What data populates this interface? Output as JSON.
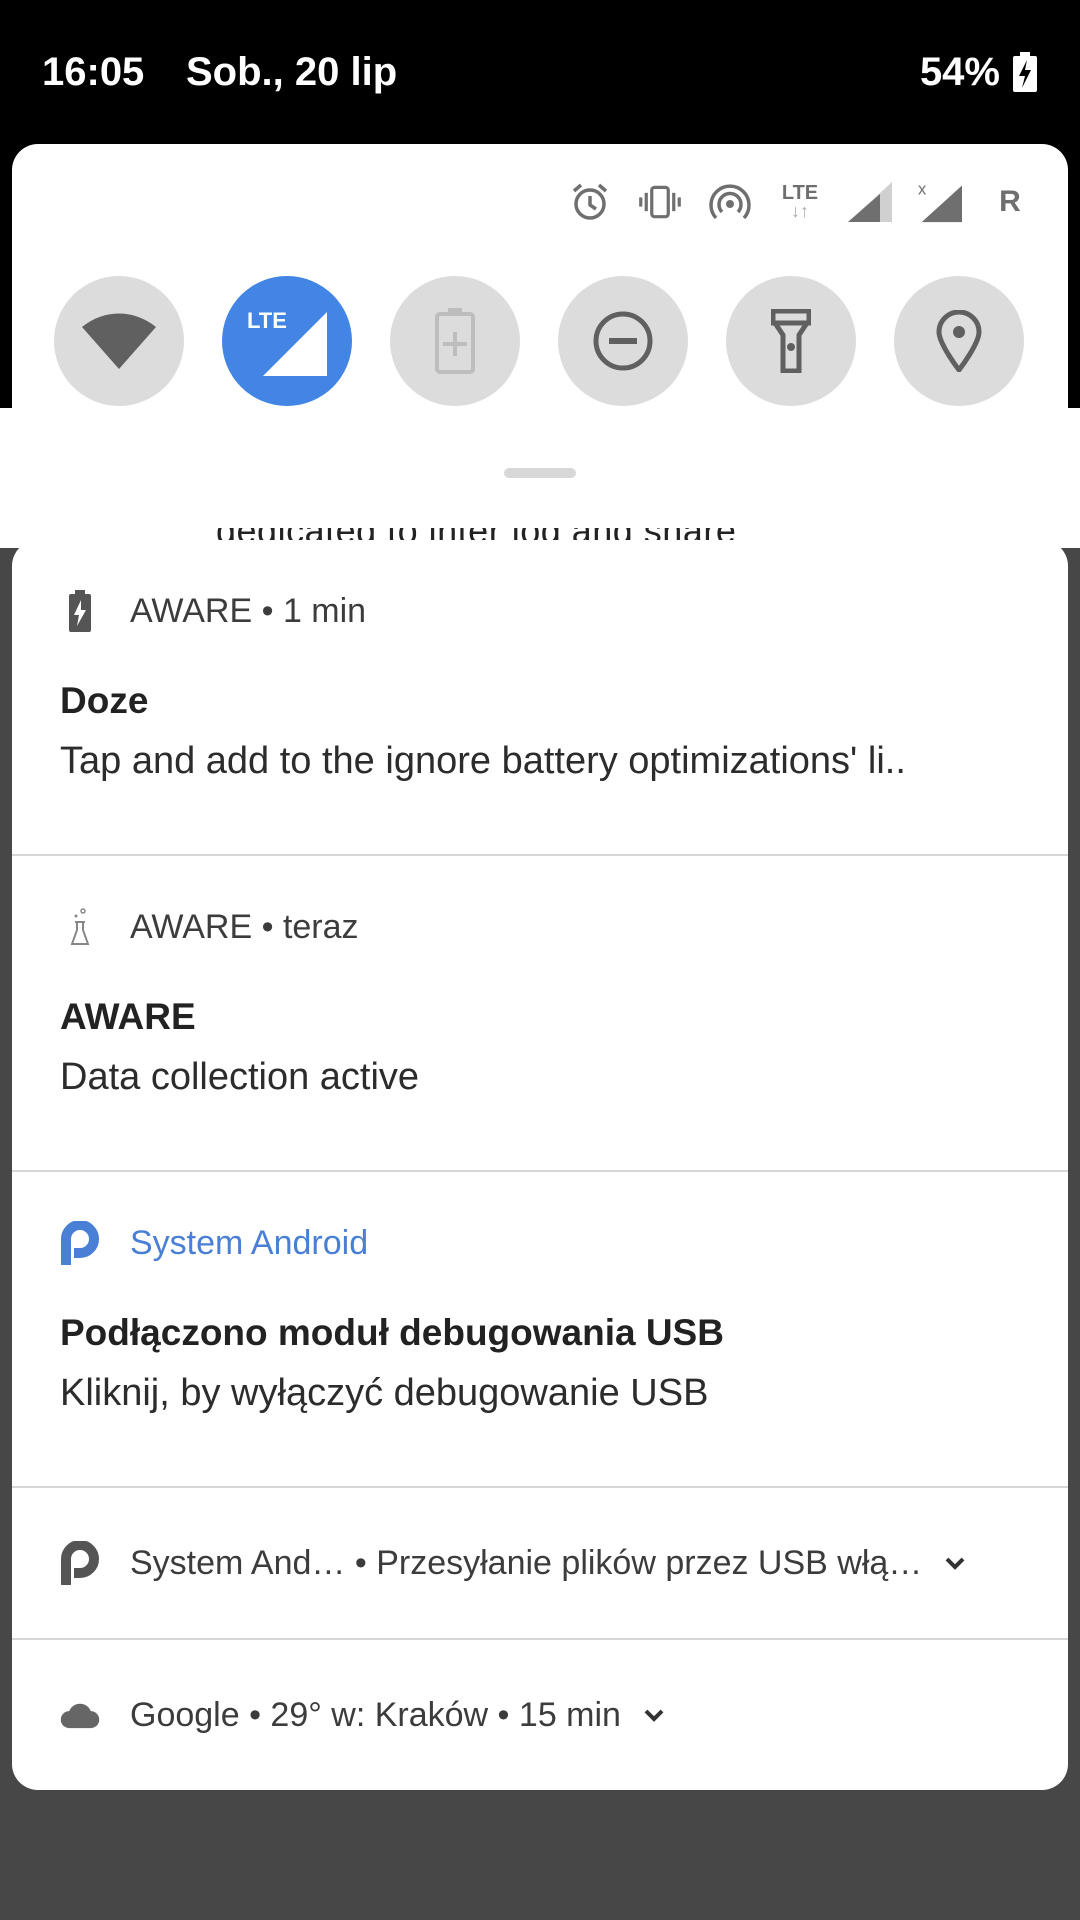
{
  "status_bar": {
    "time": "16:05",
    "date": "Sob., 20 lip",
    "battery": "54%"
  },
  "background_text": "dedicated to inter log and share",
  "quick_settings": {
    "status_icons": [
      "alarm-icon",
      "vibrate-icon",
      "hotspot-icon",
      "lte-data-icon",
      "signal-icon",
      "signal-no-data-icon",
      "roaming-icon"
    ],
    "lte_small_label": "LTE",
    "roaming_label": "R",
    "tiles": [
      {
        "name": "wifi",
        "active": false
      },
      {
        "name": "mobile-data",
        "label": "LTE",
        "active": true
      },
      {
        "name": "battery-saver",
        "active": false
      },
      {
        "name": "do-not-disturb",
        "active": false
      },
      {
        "name": "flashlight",
        "active": false
      },
      {
        "name": "location",
        "active": false
      }
    ],
    "accent": "#4285e4"
  },
  "notifications": [
    {
      "app": "AWARE",
      "time": "1 min",
      "header": "AWARE • 1 min",
      "title": "Doze",
      "text": "Tap and add to the ignore battery optimizations' li.."
    },
    {
      "app": "AWARE",
      "time": "teraz",
      "header": "AWARE • teraz",
      "title": "AWARE",
      "text": "Data collection active"
    },
    {
      "app": "System Android",
      "header": "System Android",
      "title": "Podłączono moduł debugowania USB",
      "text": "Kliknij, by wyłączyć debugowanie USB",
      "accent": "#4a7fd6"
    },
    {
      "header": "System And… • Przesyłanie plików przez USB włą…"
    },
    {
      "header": "Google • 29° w: Kraków • 15 min"
    }
  ]
}
